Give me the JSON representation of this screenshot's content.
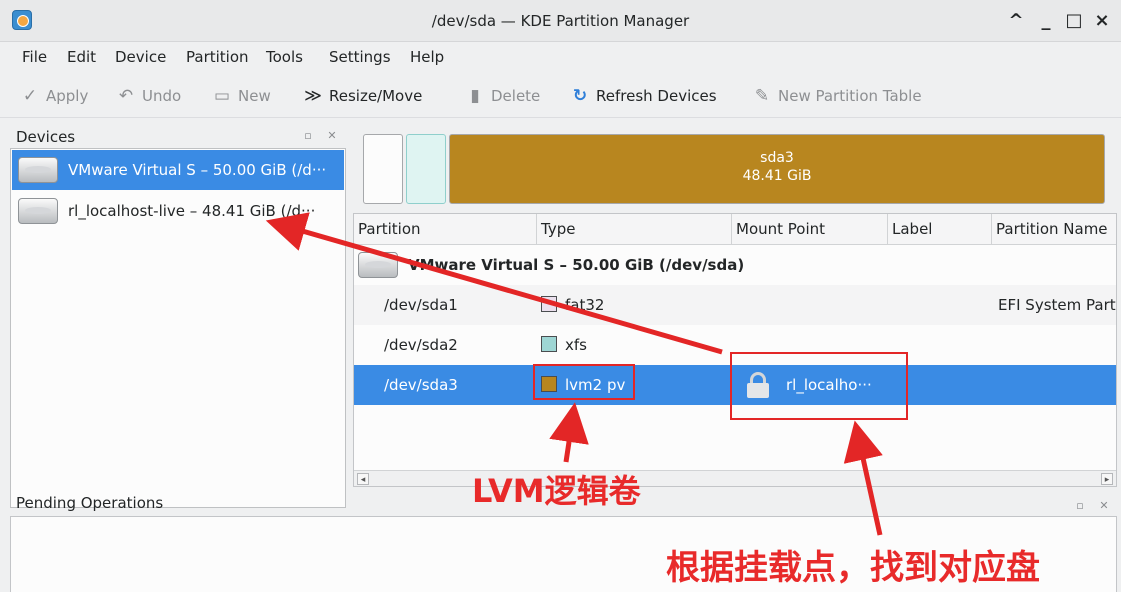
{
  "window": {
    "title": "/dev/sda — KDE Partition Manager",
    "controls": [
      "^",
      "_",
      "□",
      "×"
    ]
  },
  "menu": [
    "File",
    "Edit",
    "Device",
    "Partition",
    "Tools",
    "Settings",
    "Help"
  ],
  "toolbar": {
    "apply": "Apply",
    "undo": "Undo",
    "new": "New",
    "resize_move": "Resize/Move",
    "delete": "Delete",
    "refresh": "Refresh Devices",
    "new_partition_table": "New Partition Table"
  },
  "devices": {
    "title": "Devices",
    "items": [
      {
        "label": "VMware Virtual S – 50.00 GiB (/d···",
        "selected": true
      },
      {
        "label": "rl_localhost-live – 48.41 GiB (/d···",
        "selected": false
      }
    ]
  },
  "partition_map": {
    "sda3_name": "sda3",
    "sda3_size": "48.41 GiB"
  },
  "table": {
    "columns": [
      "Partition",
      "Type",
      "Mount Point",
      "Label",
      "Partition Name"
    ],
    "device_row": "VMware Virtual S – 50.00 GiB (/dev/sda)",
    "rows": [
      {
        "partition": "/dev/sda1",
        "type": "fat32",
        "type_color": "#ebe0ee",
        "mount": "",
        "label": "",
        "name": "EFI System Part"
      },
      {
        "partition": "/dev/sda2",
        "type": "xfs",
        "type_color": "#9ed6d4",
        "mount": "",
        "label": "",
        "name": ""
      },
      {
        "partition": "/dev/sda3",
        "type": "lvm2 pv",
        "type_color": "#b8861f",
        "mount": "rl_localho···",
        "label": "",
        "name": ""
      }
    ]
  },
  "pending": {
    "title": "Pending Operations"
  },
  "annotations": {
    "lvm": "LVM逻辑卷",
    "mount": "根据挂载点，找到对应盘"
  },
  "colors": {
    "selection": "#3a8be4",
    "annotation": "#e32626",
    "lvm": "#b8861f"
  }
}
